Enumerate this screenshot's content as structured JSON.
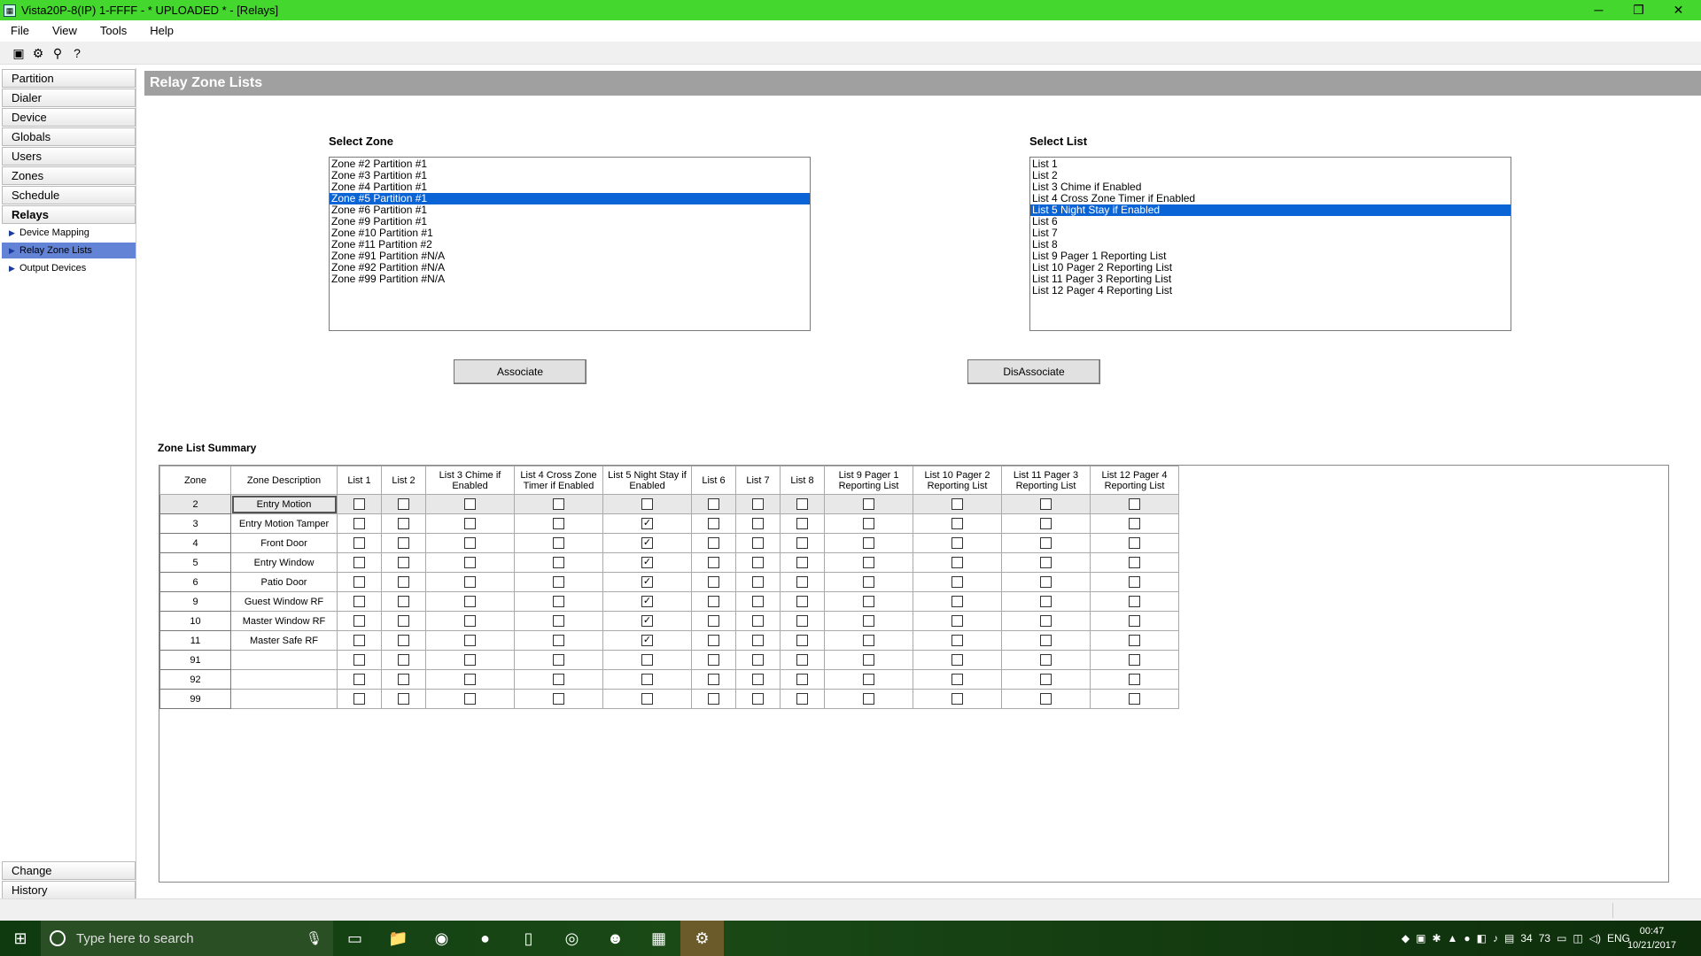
{
  "titlebar": {
    "title": "Vista20P-8(IP)  1-FFFF  - * UPLOADED * - [Relays]",
    "minimize": "─",
    "maximize": "❐",
    "close": "✕"
  },
  "menu": [
    "File",
    "View",
    "Tools",
    "Help"
  ],
  "sidebar": {
    "items": [
      "Partition",
      "Dialer",
      "Device",
      "Globals",
      "Users",
      "Zones",
      "Schedule",
      "Relays"
    ],
    "subitems": [
      "Device Mapping",
      "Relay Zone Lists",
      "Output Devices"
    ],
    "bottom": [
      "Change",
      "History"
    ]
  },
  "main": {
    "header": "Relay Zone Lists",
    "select_zone_label": "Select Zone",
    "select_list_label": "Select List",
    "zones": [
      "Zone #2 Partition #1",
      "Zone #3 Partition #1",
      "Zone #4 Partition #1",
      "Zone #5 Partition #1",
      "Zone #6 Partition #1",
      "Zone #9 Partition #1",
      "Zone #10 Partition #1",
      "Zone #11 Partition #2",
      "Zone #91 Partition #N/A",
      "Zone #92 Partition #N/A",
      "Zone #99 Partition #N/A"
    ],
    "zones_selected": 3,
    "lists": [
      "List 1",
      "List 2",
      "List 3 Chime if Enabled",
      "List 4 Cross Zone Timer if Enabled",
      "List 5 Night Stay if Enabled",
      "List 6",
      "List 7",
      "List 8",
      "List 9 Pager 1 Reporting List",
      "List 10 Pager 2 Reporting List",
      "List 11 Pager 3 Reporting List",
      "List 12 Pager 4 Reporting List"
    ],
    "lists_selected": 4,
    "associate_label": "Associate",
    "disassociate_label": "DisAssociate",
    "summary_label": "Zone List Summary"
  },
  "table": {
    "headers": [
      "Zone",
      "Zone Description",
      "List 1",
      "List 2",
      "List 3 Chime if Enabled",
      "List 4 Cross Zone Timer if Enabled",
      "List 5 Night Stay if Enabled",
      "List 6",
      "List 7",
      "List 8",
      "List 9 Pager 1 Reporting List",
      "List 10 Pager 2 Reporting List",
      "List 11 Pager 3 Reporting List",
      "List 12 Pager 4 Reporting List"
    ],
    "rows": [
      {
        "zone": "2",
        "desc": "Entry Motion",
        "checks": [
          0,
          0,
          0,
          0,
          0,
          0,
          0,
          0,
          0,
          0,
          0,
          0
        ]
      },
      {
        "zone": "3",
        "desc": "Entry Motion Tamper",
        "checks": [
          0,
          0,
          0,
          0,
          1,
          0,
          0,
          0,
          0,
          0,
          0,
          0
        ]
      },
      {
        "zone": "4",
        "desc": "Front Door",
        "checks": [
          0,
          0,
          0,
          0,
          1,
          0,
          0,
          0,
          0,
          0,
          0,
          0
        ]
      },
      {
        "zone": "5",
        "desc": "Entry Window",
        "checks": [
          0,
          0,
          0,
          0,
          1,
          0,
          0,
          0,
          0,
          0,
          0,
          0
        ]
      },
      {
        "zone": "6",
        "desc": "Patio Door",
        "checks": [
          0,
          0,
          0,
          0,
          1,
          0,
          0,
          0,
          0,
          0,
          0,
          0
        ]
      },
      {
        "zone": "9",
        "desc": "Guest Window RF",
        "checks": [
          0,
          0,
          0,
          0,
          1,
          0,
          0,
          0,
          0,
          0,
          0,
          0
        ]
      },
      {
        "zone": "10",
        "desc": "Master Window RF",
        "checks": [
          0,
          0,
          0,
          0,
          1,
          0,
          0,
          0,
          0,
          0,
          0,
          0
        ]
      },
      {
        "zone": "11",
        "desc": "Master Safe RF",
        "checks": [
          0,
          0,
          0,
          0,
          1,
          0,
          0,
          0,
          0,
          0,
          0,
          0
        ]
      },
      {
        "zone": "91",
        "desc": "",
        "checks": [
          0,
          0,
          0,
          0,
          0,
          0,
          0,
          0,
          0,
          0,
          0,
          0
        ]
      },
      {
        "zone": "92",
        "desc": "",
        "checks": [
          0,
          0,
          0,
          0,
          0,
          0,
          0,
          0,
          0,
          0,
          0,
          0
        ]
      },
      {
        "zone": "99",
        "desc": "",
        "checks": [
          0,
          0,
          0,
          0,
          0,
          0,
          0,
          0,
          0,
          0,
          0,
          0
        ]
      }
    ]
  },
  "taskbar": {
    "search_placeholder": "Type here to search",
    "tray_numbers": [
      "34",
      "73"
    ],
    "language": "ENG",
    "time": "00:47",
    "date": "10/21/2017"
  }
}
